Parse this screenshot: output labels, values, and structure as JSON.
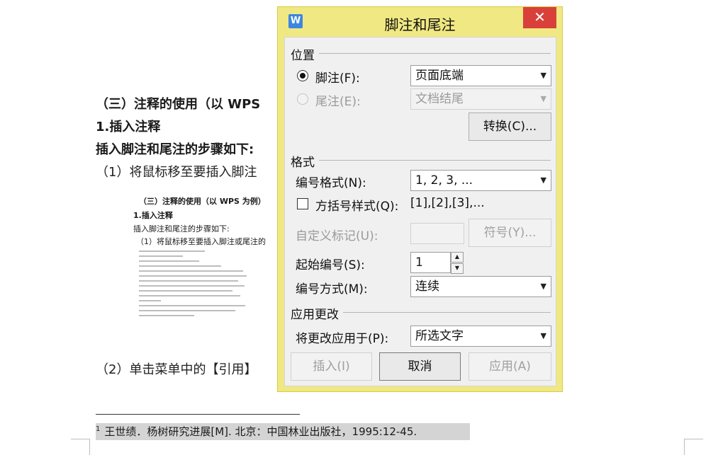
{
  "document": {
    "heading1": "（三）注释的使用（以 WPS",
    "heading2": "1.插入注释",
    "heading3": "插入脚注和尾注的步骤如下:",
    "step1": "（1）将鼠标移至要插入脚注",
    "step2": "（2）单击菜单中的【引用】",
    "thumbnail": {
      "heading1": "（三）注释的使用（以 WPS 为例）",
      "heading2": "1.插入注释",
      "line1": "插入脚注和尾注的步骤如下:",
      "line2": "（1）将鼠标移至要插入脚注或尾注的"
    },
    "footnote": {
      "number": "1",
      "text": "王世绩．杨树研究进展[M]. 北京：中国林业出版社，1995:12-45."
    }
  },
  "dialog": {
    "title": "脚注和尾注",
    "app_icon": "W",
    "close_label": "✕",
    "position_section": "位置",
    "footnote_label": "脚注(F):",
    "footnote_value": "页面底端",
    "endnote_label": "尾注(E):",
    "endnote_value": "文档结尾",
    "convert_button": "转换(C)...",
    "format_section": "格式",
    "number_format_label": "编号格式(N):",
    "number_format_value": "1, 2, 3, ...",
    "bracket_label": "方括号样式(Q):",
    "bracket_value": "[1],[2],[3],...",
    "custom_mark_label": "自定义标记(U):",
    "symbol_button": "符号(Y)...",
    "start_at_label": "起始编号(S):",
    "start_at_value": "1",
    "numbering_label": "编号方式(M):",
    "numbering_value": "连续",
    "apply_section": "应用更改",
    "apply_to_label": "将更改应用于(P):",
    "apply_to_value": "所选文字",
    "insert_button": "插入(I)",
    "cancel_button": "取消",
    "apply_button": "应用(A)"
  },
  "colors": {
    "dialog_frame": "#f0e882",
    "close_button": "#d9403a",
    "app_icon": "#3d86e0"
  }
}
